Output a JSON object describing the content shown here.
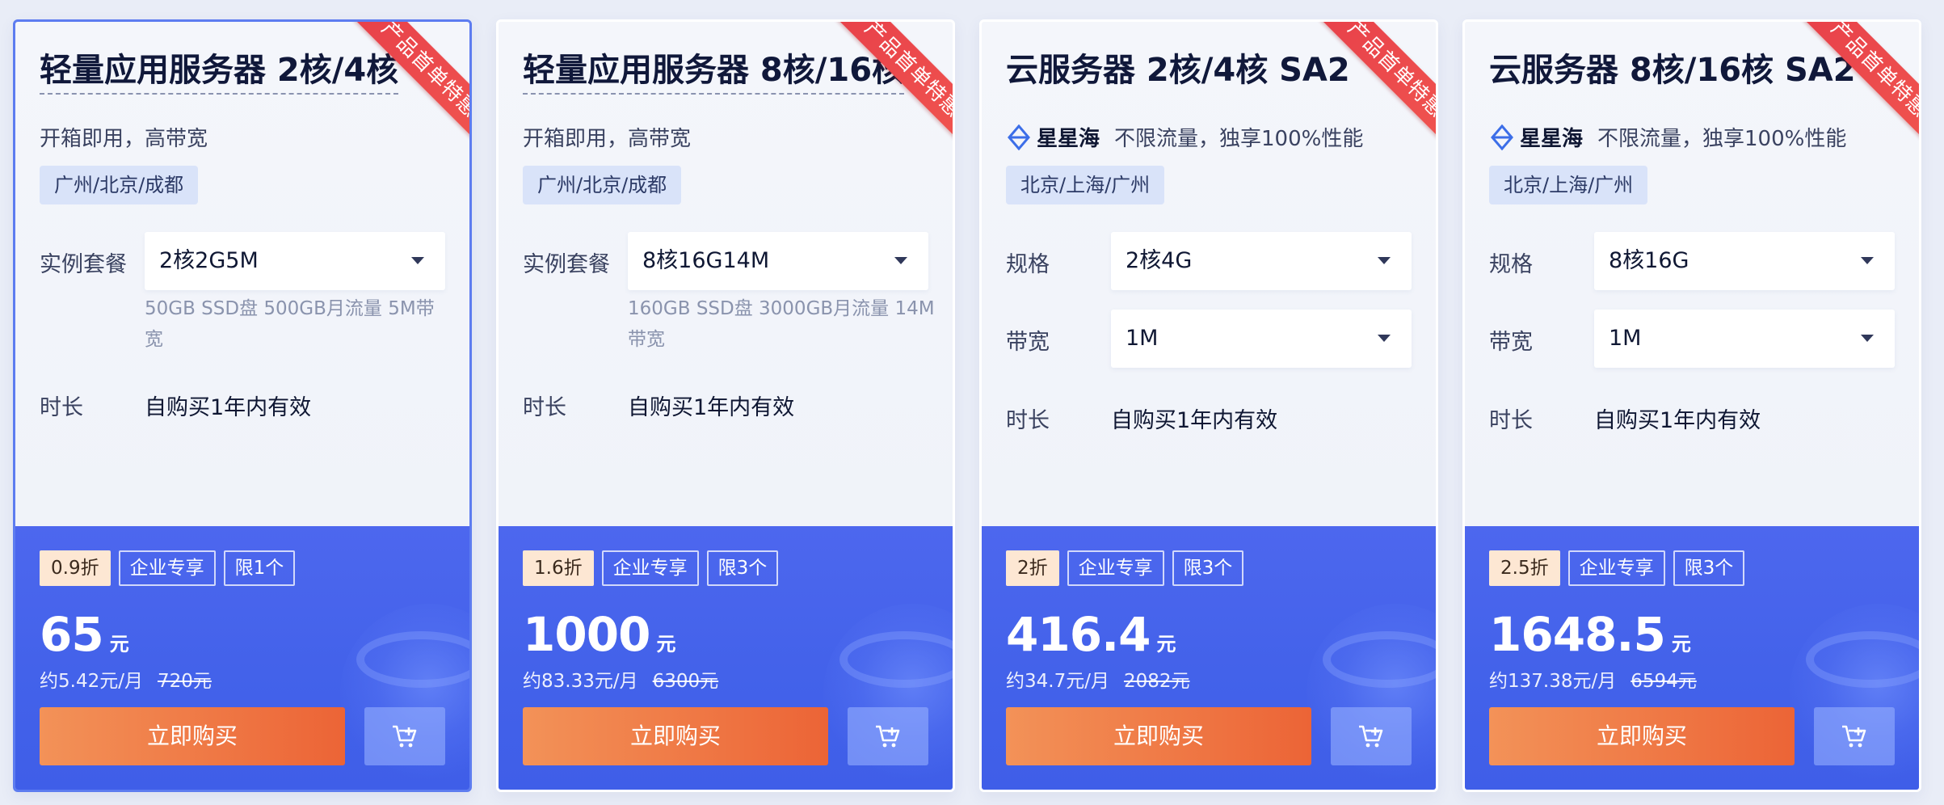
{
  "ribbon_text": "产品首单特惠",
  "cards": [
    {
      "title": "轻量应用服务器 2核/4核",
      "subtitle": "开箱即用，高带宽",
      "brand": "",
      "region": "广州/北京/成都",
      "row1_label": "实例套餐",
      "row1_value": "2核2G5M",
      "desc": "50GB SSD盘 500GB月流量 5M带宽",
      "duration_label": "时长",
      "duration_value": "自购买1年内有效",
      "discount": "0.9折",
      "badge_enterprise": "企业专享",
      "badge_limit": "限1个",
      "price": "65",
      "price_unit": "元",
      "monthly": "约5.42元/月",
      "original": "720元",
      "buy_label": "立即购买"
    },
    {
      "title": "轻量应用服务器 8核/16核",
      "subtitle": "开箱即用，高带宽",
      "brand": "",
      "region": "广州/北京/成都",
      "row1_label": "实例套餐",
      "row1_value": "8核16G14M",
      "desc": "160GB SSD盘 3000GB月流量 14M带宽",
      "duration_label": "时长",
      "duration_value": "自购买1年内有效",
      "discount": "1.6折",
      "badge_enterprise": "企业专享",
      "badge_limit": "限3个",
      "price": "1000",
      "price_unit": "元",
      "monthly": "约83.33元/月",
      "original": "6300元",
      "buy_label": "立即购买"
    },
    {
      "title": "云服务器 2核/4核 SA2",
      "subtitle": "不限流量，独享100%性能",
      "brand": "星星海",
      "region": "北京/上海/广州",
      "row1_label": "规格",
      "row1_value": "2核4G",
      "row2_label": "带宽",
      "row2_value": "1M",
      "duration_label": "时长",
      "duration_value": "自购买1年内有效",
      "discount": "2折",
      "badge_enterprise": "企业专享",
      "badge_limit": "限3个",
      "price": "416.4",
      "price_unit": "元",
      "monthly": "约34.7元/月",
      "original": "2082元",
      "buy_label": "立即购买"
    },
    {
      "title": "云服务器 8核/16核 SA2",
      "subtitle": "不限流量，独享100%性能",
      "brand": "星星海",
      "region": "北京/上海/广州",
      "row1_label": "规格",
      "row1_value": "8核16G",
      "row2_label": "带宽",
      "row2_value": "1M",
      "duration_label": "时长",
      "duration_value": "自购买1年内有效",
      "discount": "2.5折",
      "badge_enterprise": "企业专享",
      "badge_limit": "限3个",
      "price": "1648.5",
      "price_unit": "元",
      "monthly": "约137.38元/月",
      "original": "6594元",
      "buy_label": "立即购买"
    }
  ]
}
